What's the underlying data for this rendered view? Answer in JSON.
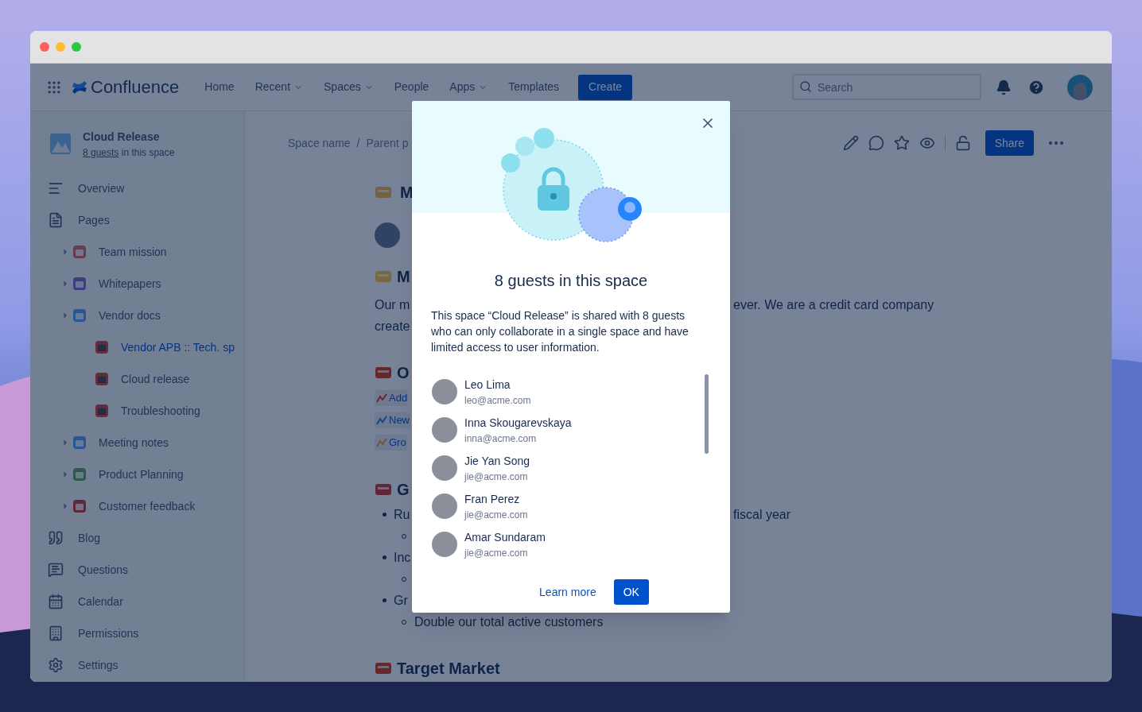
{
  "nav": {
    "product": "Confluence",
    "items": [
      {
        "label": "Home",
        "dropdown": false
      },
      {
        "label": "Recent",
        "dropdown": true
      },
      {
        "label": "Spaces",
        "dropdown": true
      },
      {
        "label": "People",
        "dropdown": false
      },
      {
        "label": "Apps",
        "dropdown": true
      },
      {
        "label": "Templates",
        "dropdown": false
      }
    ],
    "create": "Create",
    "search": {
      "placeholder": "Search"
    }
  },
  "sidebar": {
    "space": {
      "name": "Cloud Release",
      "guests_link": "8 guests",
      "guests_suffix": "in this space"
    },
    "items": [
      {
        "label": "Overview",
        "selected": false
      },
      {
        "label": "Pages",
        "selected": false,
        "children": [
          {
            "label": "Team mission",
            "selected": false
          },
          {
            "label": "Whitepapers",
            "selected": false
          },
          {
            "label": "Vendor docs",
            "selected": false,
            "children": [
              {
                "label": "Vendor APB :: Tech. sp",
                "selected": true
              },
              {
                "label": "Cloud release",
                "selected": false
              },
              {
                "label": "Troubleshooting",
                "selected": false
              }
            ]
          },
          {
            "label": "Meeting notes",
            "selected": false
          },
          {
            "label": "Product Planning",
            "selected": false
          },
          {
            "label": "Customer feedback",
            "selected": false
          }
        ]
      },
      {
        "label": "Blog",
        "selected": false
      },
      {
        "label": "Questions",
        "selected": false
      },
      {
        "label": "Calendar",
        "selected": false
      },
      {
        "label": "Permissions",
        "selected": false
      },
      {
        "label": "Settings",
        "selected": false
      }
    ]
  },
  "page": {
    "breadcrumb": {
      "separator": "/",
      "items": [
        "Space name",
        "Parent p"
      ]
    },
    "share": "Share",
    "blocks": [
      {
        "kind": "title",
        "left": "M"
      },
      {
        "kind": "author"
      },
      {
        "kind": "heading",
        "left": "M"
      },
      {
        "kind": "text",
        "left": "Our m",
        "right": "ever. We are a credit card company"
      },
      {
        "kind": "text",
        "left": "create"
      },
      {
        "kind": "heading",
        "left": "O"
      },
      {
        "kind": "chip",
        "left": "Add"
      },
      {
        "kind": "chip",
        "left": "New"
      },
      {
        "kind": "chip",
        "left": "Gro"
      },
      {
        "kind": "heading",
        "left": "G"
      },
      {
        "kind": "bullet",
        "left": "Ru",
        "right": "fiscal year"
      },
      {
        "kind": "sub_bullet"
      },
      {
        "kind": "bullet",
        "left": "Inc"
      },
      {
        "kind": "sub_bullet"
      },
      {
        "kind": "bullet",
        "left": "Gr"
      },
      {
        "kind": "sub_bullet",
        "left": "Double our total active customers"
      },
      {
        "kind": "heading",
        "left": "Target Market"
      }
    ]
  },
  "dialog": {
    "title": "8 guests in this space",
    "body": "This space “Cloud Release” is shared with 8 guests who can only collaborate in a single space and have limited access to user information.",
    "guests": [
      {
        "name": "Leo Lima",
        "email": "leo@acme.com"
      },
      {
        "name": "Inna Skougarevskaya",
        "email": "inna@acme.com"
      },
      {
        "name": "Jie Yan Song",
        "email": "jie@acme.com"
      },
      {
        "name": "Fran Perez",
        "email": "jie@acme.com"
      },
      {
        "name": "Amar Sundaram",
        "email": "jie@acme.com"
      }
    ],
    "learn_more": "Learn more",
    "ok": "OK"
  }
}
